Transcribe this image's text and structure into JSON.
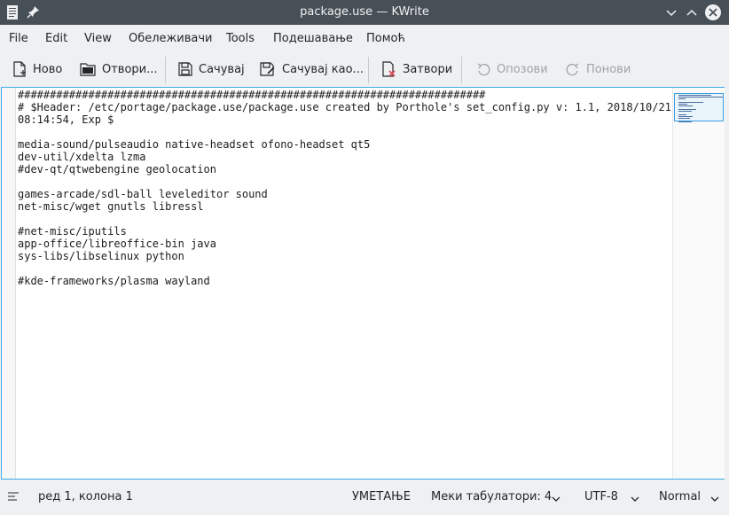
{
  "window": {
    "title": "package.use — KWrite"
  },
  "menu": {
    "items": [
      "File",
      "Edit",
      "View",
      "Обележивачи",
      "Tools",
      "Подешавање",
      "Помоћ"
    ]
  },
  "toolbar": {
    "new_label": "Ново",
    "open_label": "Отвори...",
    "save_label": "Сачувај",
    "save_as_label": "Сачувај као...",
    "close_label": "Затвори",
    "undo_label": "Опозови",
    "redo_label": "Понови"
  },
  "editor": {
    "lines": [
      "#########################################################################",
      "# $Header: /etc/portage/package.use/package.use created by Porthole's set_config.py v: 1.1, 2018/10/21",
      "08:14:54, Exp $",
      "",
      "media-sound/pulseaudio native-headset ofono-headset qt5",
      "dev-util/xdelta lzma",
      "#dev-qt/qtwebengine geolocation",
      "",
      "games-arcade/sdl-ball leveleditor sound",
      "net-misc/wget gnutls libressl",
      "",
      "#net-misc/iputils",
      "app-office/libreoffice-bin java",
      "sys-libs/libselinux python",
      "",
      "#kde-frameworks/plasma wayland"
    ]
  },
  "status": {
    "position": "ред 1, колона 1",
    "insert_mode": "УМЕТАЊЕ",
    "indent": "Меки табулатори: 4",
    "encoding": "UTF-8",
    "mode": "Normal"
  },
  "colors": {
    "titlebar": "#475057",
    "focus": "#3daee9",
    "close_icon": "#da4453"
  }
}
